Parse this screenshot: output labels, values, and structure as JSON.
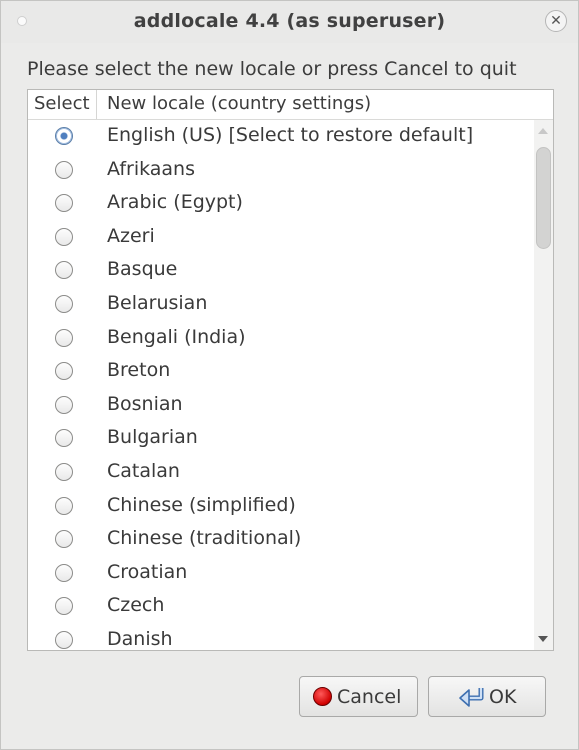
{
  "window": {
    "title": "addlocale 4.4 (as superuser)"
  },
  "prompt": "Please select the new locale or press Cancel to quit",
  "table": {
    "columns": [
      "Select",
      "New locale (country settings)"
    ],
    "rows": [
      {
        "label": "English (US) [Select to restore default]",
        "selected": true
      },
      {
        "label": "Afrikaans",
        "selected": false
      },
      {
        "label": "Arabic (Egypt)",
        "selected": false
      },
      {
        "label": "Azeri",
        "selected": false
      },
      {
        "label": "Basque",
        "selected": false
      },
      {
        "label": "Belarusian",
        "selected": false
      },
      {
        "label": "Bengali (India)",
        "selected": false
      },
      {
        "label": "Breton",
        "selected": false
      },
      {
        "label": "Bosnian",
        "selected": false
      },
      {
        "label": "Bulgarian",
        "selected": false
      },
      {
        "label": "Catalan",
        "selected": false
      },
      {
        "label": "Chinese (simplified)",
        "selected": false
      },
      {
        "label": "Chinese (traditional)",
        "selected": false
      },
      {
        "label": "Croatian",
        "selected": false
      },
      {
        "label": "Czech",
        "selected": false
      },
      {
        "label": "Danish",
        "selected": false
      }
    ]
  },
  "buttons": {
    "cancel_label": "Cancel",
    "ok_label": "OK"
  },
  "icons": {
    "close": "close-icon",
    "cancel": "stop-icon",
    "ok": "enter-arrow-icon"
  },
  "colors": {
    "radio_selected": "#4f7fbf",
    "cancel_icon": "#d00000"
  }
}
